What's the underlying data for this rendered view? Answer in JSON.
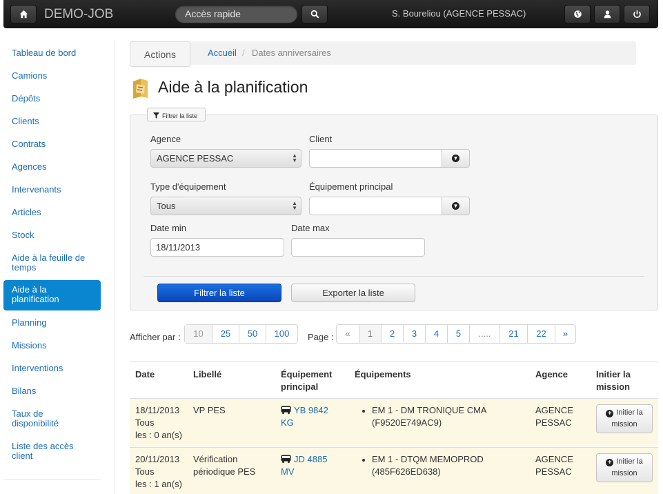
{
  "navbar": {
    "brand": "DEMO-JOB",
    "quick_access_placeholder": "Accès rapide",
    "user": "S. Boureliou (AGENCE PESSAC)"
  },
  "sidebar": {
    "items": [
      {
        "label": "Tableau de bord"
      },
      {
        "label": "Camions"
      },
      {
        "label": "Dépôts"
      },
      {
        "label": "Clients"
      },
      {
        "label": "Contrats"
      },
      {
        "label": "Agences"
      },
      {
        "label": "Intervenants"
      },
      {
        "label": "Articles"
      },
      {
        "label": "Stock"
      },
      {
        "label": "Aide à la feuille de temps"
      },
      {
        "label": "Aide à la planification",
        "active": true
      },
      {
        "label": "Planning"
      },
      {
        "label": "Missions"
      },
      {
        "label": "Interventions"
      },
      {
        "label": "Bilans"
      },
      {
        "label": "Taux de disponibilité"
      },
      {
        "label": "Liste des accès client"
      }
    ]
  },
  "breadcrumb": {
    "actions": "Actions",
    "home": "Accueil",
    "separator": "/",
    "current": "Dates anniversaires"
  },
  "page": {
    "title": "Aide à la planification"
  },
  "filter": {
    "tab_label": "Filtrer la liste",
    "agence_label": "Agence",
    "agence_value": "AGENCE PESSAC",
    "client_label": "Client",
    "client_value": "",
    "type_label": "Type d'équipement",
    "type_value": "Tous",
    "equip_label": "Équipement principal",
    "equip_value": "",
    "date_min_label": "Date min",
    "date_min_value": "18/11/2013",
    "date_max_label": "Date max",
    "date_max_value": "",
    "submit_label": "Filtrer la liste",
    "export_label": "Exporter la liste"
  },
  "paging": {
    "per_page_label": "Afficher par :",
    "per_page_options": [
      "10",
      "25",
      "50",
      "100"
    ],
    "per_page_selected": "10",
    "page_label": "Page :",
    "pages": [
      "«",
      "1",
      "2",
      "3",
      "4",
      "5",
      ".....",
      "21",
      "22",
      "»"
    ],
    "current_page": "1"
  },
  "table": {
    "headers": {
      "date": "Date",
      "libelle": "Libellé",
      "equip_principal": "Équipement principal",
      "equipements": "Équipements",
      "agence": "Agence",
      "initier": "Initier la mission"
    },
    "rows": [
      {
        "date": "18/11/2013",
        "type": "Tous",
        "age": "les : 0 an(s)",
        "libelle": "VP PES",
        "equip_principal": "YB 9842 KG",
        "equipement_name": "EM 1 - DM TRONIQUE CMA",
        "equipement_code": "(F9520E749AC9)",
        "agence": "AGENCE PESSAC",
        "action": "Initier la mission"
      },
      {
        "date": "20/11/2013",
        "type": "Tous",
        "age": "les : 1 an(s)",
        "libelle": "Vérification périodique PES",
        "equip_principal": "JD 4885 MV",
        "equipement_name": "EM 1 - DTQM MEMOPROD",
        "equipement_code": "(485F626ED638)",
        "agence": "AGENCE PESSAC",
        "action": "Initier la mission"
      }
    ]
  }
}
